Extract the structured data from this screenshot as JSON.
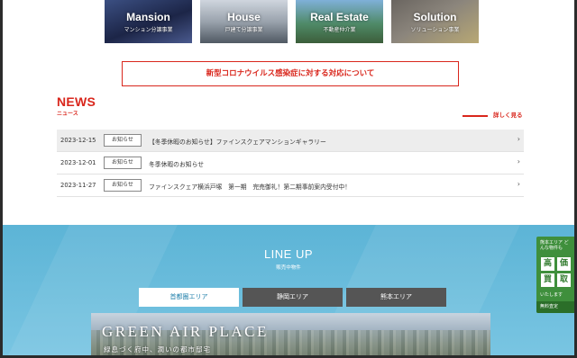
{
  "tiles": [
    {
      "title": "Mansion",
      "subtitle": "マンション分譲事業"
    },
    {
      "title": "House",
      "subtitle": "戸建て分譲事業"
    },
    {
      "title": "Real Estate",
      "subtitle": "不動産仲介業"
    },
    {
      "title": "Solution",
      "subtitle": "ソリューション事業"
    }
  ],
  "notice": {
    "text": "新型コロナウイルス感染症に対する対応について"
  },
  "news": {
    "title": "NEWS",
    "subtitle": "ニュース",
    "more_label": "詳しく見る",
    "items": [
      {
        "date": "2023-12-15",
        "badge": "お知らせ",
        "title": "【冬季休暇のお知らせ】ファインスクェアマンションギャラリー"
      },
      {
        "date": "2023-12-01",
        "badge": "お知らせ",
        "title": "冬季休暇のお知らせ"
      },
      {
        "date": "2023-11-27",
        "badge": "お知らせ",
        "title": "ファインスクェア横浜戸塚　第一期　完売御礼！第二期事前案内受付中！"
      }
    ]
  },
  "lineup": {
    "title": "LINE UP",
    "subtitle": "販売中物件",
    "tabs": [
      {
        "label": "首都圏エリア",
        "active": true
      },
      {
        "label": "静岡エリア",
        "active": false
      },
      {
        "label": "熊本エリア",
        "active": false
      }
    ],
    "hero": {
      "title": "GREEN AIR PLACE",
      "subtitle": "緑息づく府中、潤いの都市邸宅"
    }
  },
  "side_banner": {
    "top_text": "熊本エリア どんな物件も",
    "chars": [
      "高",
      "価",
      "買",
      "取"
    ],
    "bottom_text": "いたします",
    "footer": "無料査定"
  },
  "colors": {
    "accent_red": "#d9261c",
    "lineup_blue": "#5cb4d6",
    "banner_green": "#3f8f3c"
  }
}
